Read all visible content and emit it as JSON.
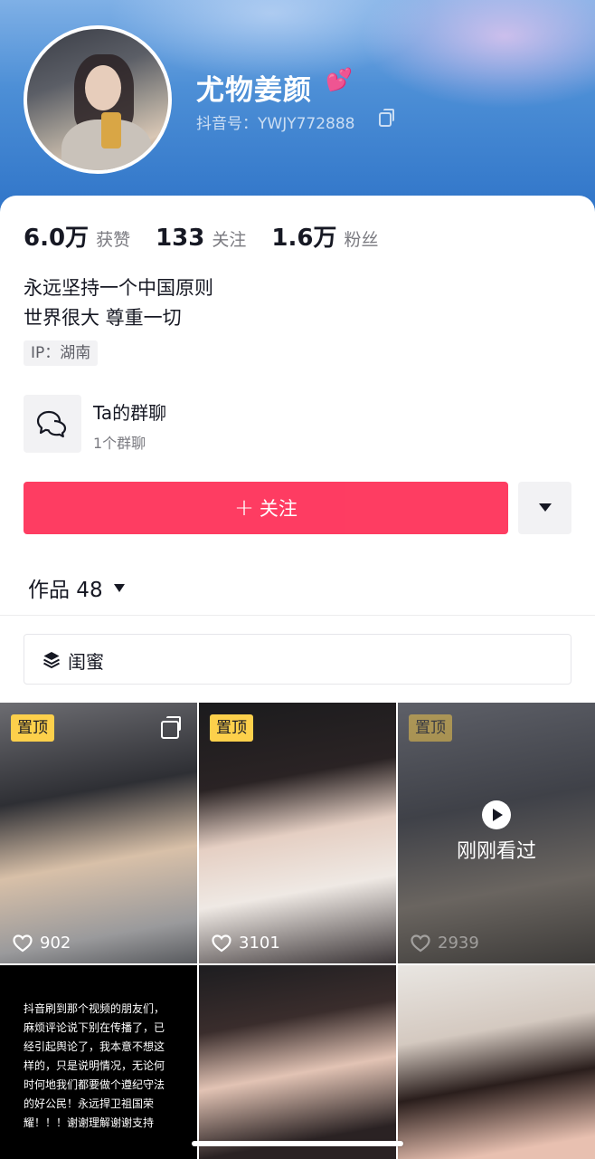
{
  "profile": {
    "nickname": "尤物姜颜",
    "nickname_emoji": "💕",
    "douyin_id": "抖音号：YWJY772888"
  },
  "stats": [
    {
      "value": "6.0万",
      "label": "获赞"
    },
    {
      "value": "133",
      "label": "关注"
    },
    {
      "value": "1.6万",
      "label": "粉丝"
    }
  ],
  "bio": {
    "line1": "永远坚持一个中国原则",
    "line2": "世界很大 尊重一切"
  },
  "ip": "IP：湖南",
  "group_chat": {
    "title": "Ta的群聊",
    "subtitle": "1个群聊"
  },
  "actions": {
    "follow_plus": "+",
    "follow_label": "关注"
  },
  "works_tab": {
    "label": "作品 48"
  },
  "collection": {
    "label": "闺蜜"
  },
  "videos": [
    {
      "badge": "置顶",
      "likes": "902",
      "multi": true
    },
    {
      "badge": "置顶",
      "likes": "3101"
    },
    {
      "badge": "置顶",
      "likes": "2939",
      "overlay": "刚刚看过"
    },
    {
      "text": "抖音刷到那个视频的朋友们，麻烦评论说下别在传播了，已经引起舆论了，我本意不想这样的，只是说明情况，无论何时何地我们都要做个遵纪守法的好公民！永远捍卫祖国荣耀！！！谢谢理解谢谢支持"
    },
    {},
    {}
  ],
  "colors": {
    "follow_button": "#fe2c55",
    "pin_badge": "#fdd04b",
    "header_blue": "#2f74c8"
  }
}
